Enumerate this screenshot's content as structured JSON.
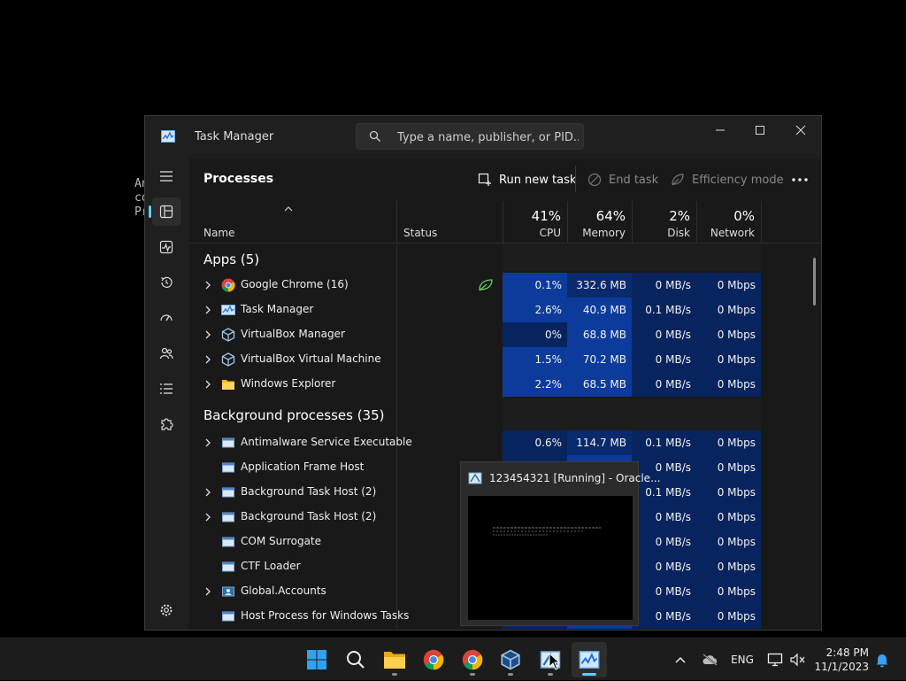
{
  "desktop": {
    "fragment_lines": [
      "An",
      "co",
      "Pr"
    ]
  },
  "window": {
    "title": "Task Manager",
    "search_placeholder": "Type a name, publisher, or PID...",
    "page_title": "Processes",
    "run_new_task": "Run new task",
    "end_task": "End task",
    "efficiency_mode": "Efficiency mode"
  },
  "columns": {
    "name": "Name",
    "status": "Status",
    "cpu": {
      "pct": "41%",
      "label": "CPU"
    },
    "memory": {
      "pct": "64%",
      "label": "Memory"
    },
    "disk": {
      "pct": "2%",
      "label": "Disk"
    },
    "network": {
      "pct": "0%",
      "label": "Network"
    }
  },
  "groups": {
    "apps": "Apps (5)",
    "background": "Background processes (35)"
  },
  "apps": [
    {
      "name": "Google Chrome (16)",
      "cpu": "0.1%",
      "mem": "332.6 MB",
      "disk": "0 MB/s",
      "net": "0 Mbps",
      "icon": "chrome-icon"
    },
    {
      "name": "Task Manager",
      "cpu": "2.6%",
      "mem": "40.9 MB",
      "disk": "0.1 MB/s",
      "net": "0 Mbps",
      "icon": "task-manager-icon"
    },
    {
      "name": "VirtualBox Manager",
      "cpu": "0%",
      "mem": "68.8 MB",
      "disk": "0 MB/s",
      "net": "0 Mbps",
      "icon": "virtualbox-icon"
    },
    {
      "name": "VirtualBox Virtual Machine",
      "cpu": "1.5%",
      "mem": "70.2 MB",
      "disk": "0 MB/s",
      "net": "0 Mbps",
      "icon": "virtualbox-icon"
    },
    {
      "name": "Windows Explorer",
      "cpu": "2.2%",
      "mem": "68.5 MB",
      "disk": "0 MB/s",
      "net": "0 Mbps",
      "icon": "folder-icon"
    }
  ],
  "background": [
    {
      "name": "Antimalware Service Executable",
      "cpu": "0.6%",
      "mem": "114.7 MB",
      "disk": "0.1 MB/s",
      "net": "0 Mbps"
    },
    {
      "name": "Application Frame Host",
      "disk": "0 MB/s",
      "net": "0 Mbps"
    },
    {
      "name": "Background Task Host (2)",
      "disk": "0.1 MB/s",
      "net": "0 Mbps"
    },
    {
      "name": "Background Task Host (2)",
      "disk": "0 MB/s",
      "net": "0 Mbps"
    },
    {
      "name": "COM Surrogate",
      "disk": "0 MB/s",
      "net": "0 Mbps"
    },
    {
      "name": "CTF Loader",
      "disk": "0 MB/s",
      "net": "0 Mbps"
    },
    {
      "name": "Global.Accounts",
      "disk": "0 MB/s",
      "net": "0 Mbps"
    },
    {
      "name": "Host Process for Windows Tasks",
      "disk": "0 MB/s",
      "net": "0 Mbps"
    }
  ],
  "preview": {
    "title": "123454321 [Running] - Oracle..."
  },
  "tray": {
    "lang": "ENG",
    "time": "2:48 PM",
    "date": "11/1/2023"
  },
  "colors": {
    "accent": "#60cdff",
    "heat_light": "#0a2a6e",
    "heat_mid": "#0c3b9c",
    "heat_dark": "#08245f"
  }
}
